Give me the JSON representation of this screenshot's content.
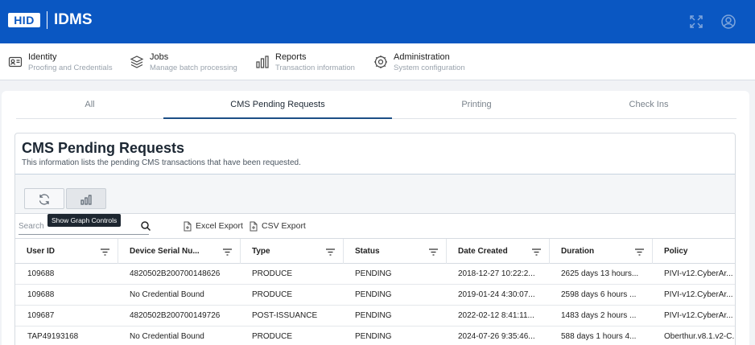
{
  "header": {
    "logo_text": "HID",
    "app_title": "IDMS",
    "fullscreen_icon": "expand-icon",
    "user_icon": "user-circle-icon"
  },
  "nav": [
    {
      "label": "Identity",
      "sub": "Proofing and Credentials",
      "icon": "id-card-icon"
    },
    {
      "label": "Jobs",
      "sub": "Manage batch processing",
      "icon": "layers-icon"
    },
    {
      "label": "Reports",
      "sub": "Transaction information",
      "icon": "bar-chart-icon"
    },
    {
      "label": "Administration",
      "sub": "System configuration",
      "icon": "gear-icon"
    }
  ],
  "tabs": [
    {
      "label": "All",
      "active": false
    },
    {
      "label": "CMS Pending Requests",
      "active": true
    },
    {
      "label": "Printing",
      "active": false
    },
    {
      "label": "Check Ins",
      "active": false
    }
  ],
  "panel": {
    "title": "CMS Pending Requests",
    "description": "This information lists the pending CMS transactions that have been requested."
  },
  "toolbar": {
    "refresh_icon": "refresh-icon",
    "graph_icon": "bar-chart-icon",
    "tooltip": "Show Graph Controls",
    "search_placeholder": "Search",
    "excel_export": "Excel Export",
    "csv_export": "CSV Export"
  },
  "table": {
    "columns": [
      "User ID",
      "Device Serial Nu...",
      "Type",
      "Status",
      "Date Created",
      "Duration",
      "Policy"
    ],
    "rows": [
      [
        "109688",
        "4820502B200700148626",
        "PRODUCE",
        "PENDING",
        "2018-12-27 10:22:2...",
        "2625 days 13 hours...",
        "PIVI-v12.CyberAr..."
      ],
      [
        "109688",
        "No Credential Bound",
        "PRODUCE",
        "PENDING",
        "2019-01-24 4:30:07...",
        "2598 days 6 hours ...",
        "PIVI-v12.CyberAr..."
      ],
      [
        "109687",
        "4820502B200700149726",
        "POST-ISSUANCE",
        "PENDING",
        "2022-02-12 8:41:11...",
        "1483 days 2 hours ...",
        "PIVI-v12.CyberAr..."
      ],
      [
        "TAP49193168",
        "No Credential Bound",
        "PRODUCE",
        "PENDING",
        "2024-07-26 9:35:46...",
        "588 days 1 hours 4...",
        "Oberthur.v8.1.v2-C..."
      ]
    ]
  },
  "colors": {
    "brand": "#0a57c2",
    "active_tab_underline": "#1c4f86"
  }
}
